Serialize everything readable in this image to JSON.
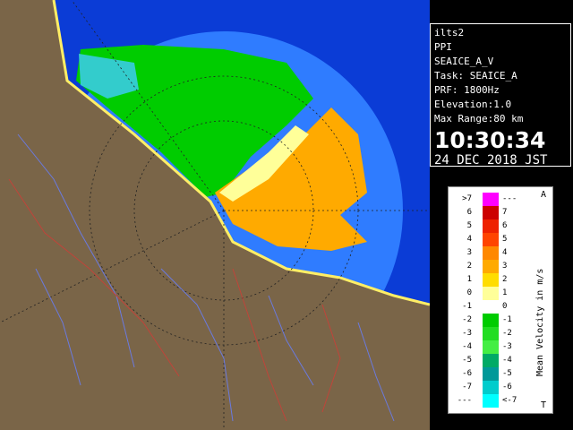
{
  "info": {
    "site": "ilts2",
    "product": "PPI",
    "task_file": "SEAICE_A_V",
    "task": "Task: SEAICE_A",
    "prf": "PRF: 1800Hz",
    "elevation": "Elevation:1.0",
    "max_range": "Max Range:80 km",
    "time": "10:30:34",
    "date": "24 DEC 2018 JST"
  },
  "legend": {
    "title": "Mean Velocity in m/s",
    "corner_top": "A",
    "corner_bottom": "T",
    "rows": [
      {
        "left": ">7",
        "right": "---",
        "color": "#ff00ff"
      },
      {
        "left": "6",
        "right": "7",
        "color": "#cc0000"
      },
      {
        "left": "5",
        "right": "6",
        "color": "#ee2200"
      },
      {
        "left": "4",
        "right": "5",
        "color": "#ff4400"
      },
      {
        "left": "3",
        "right": "4",
        "color": "#ff8800"
      },
      {
        "left": "2",
        "right": "3",
        "color": "#ffaa00"
      },
      {
        "left": "1",
        "right": "2",
        "color": "#ffdd00"
      },
      {
        "left": "0",
        "right": "1",
        "color": "#ffff99"
      },
      {
        "left": "-1",
        "right": "0",
        "color": "#ffffff"
      },
      {
        "left": "-2",
        "right": "-1",
        "color": "#00cc00"
      },
      {
        "left": "-3",
        "right": "-2",
        "color": "#22dd22"
      },
      {
        "left": "-4",
        "right": "-3",
        "color": "#44ee44"
      },
      {
        "left": "-5",
        "right": "-4",
        "color": "#00aa66"
      },
      {
        "left": "-6",
        "right": "-5",
        "color": "#009999"
      },
      {
        "left": "-7",
        "right": "-6",
        "color": "#00cccc"
      },
      {
        "left": "---",
        "right": "<-7",
        "color": "#00ffff"
      }
    ]
  },
  "colors": {
    "sea": "#0b3cd6",
    "range_disc": "#2f7cff",
    "land": "#7a6548",
    "approaching": "#00cc00",
    "receding": "#ffaa00"
  }
}
